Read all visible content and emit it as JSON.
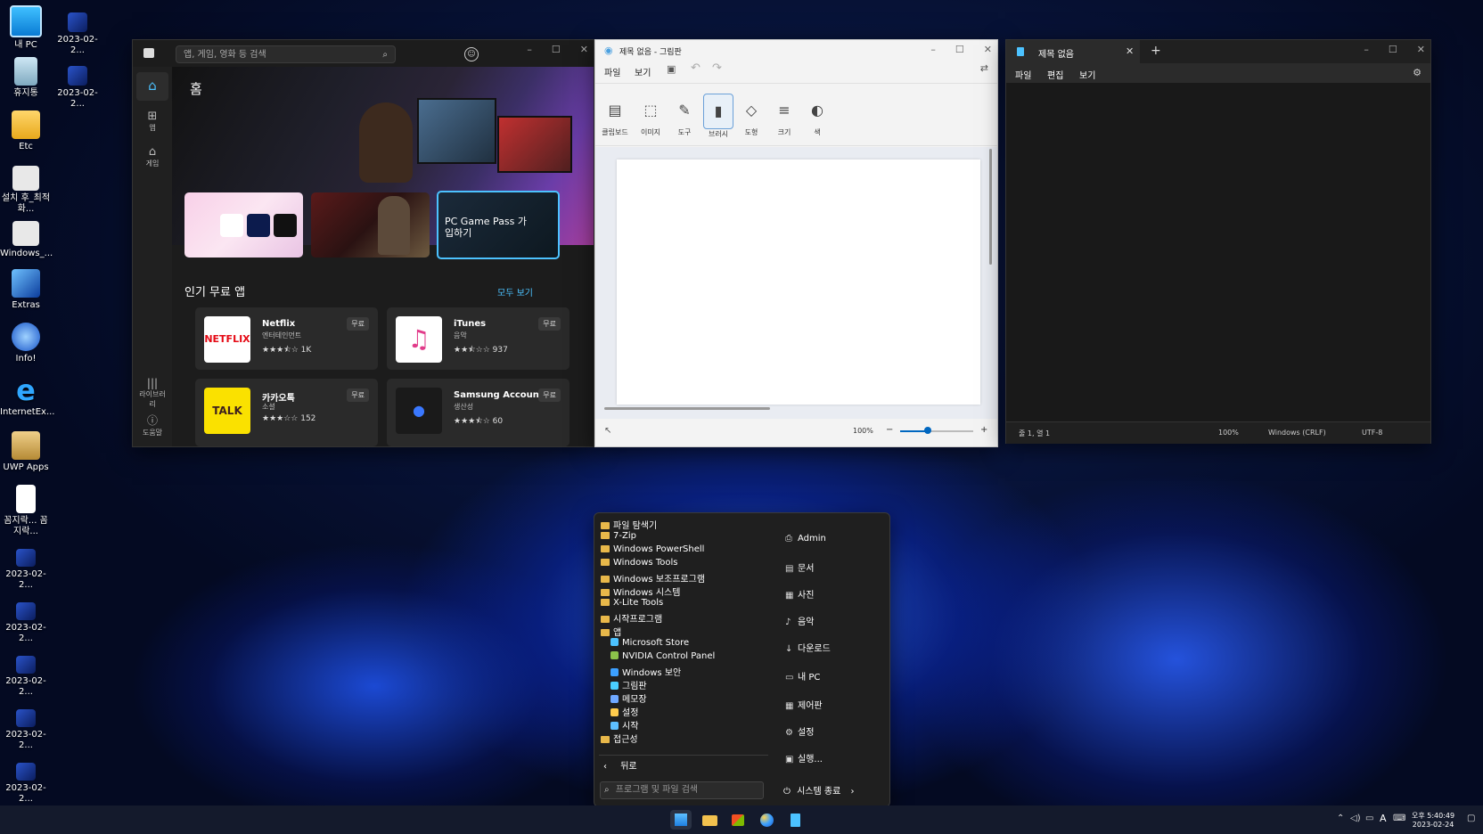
{
  "desktop": {
    "icons": [
      {
        "label": "내 PC"
      },
      {
        "label": "2023-02-2..."
      },
      {
        "label": "휴지통"
      },
      {
        "label": "2023-02-2..."
      },
      {
        "label": "Etc"
      },
      {
        "label": "설치 후_최적화..."
      },
      {
        "label": "Windows_..."
      },
      {
        "label": "Extras"
      },
      {
        "label": "Info!"
      },
      {
        "label": "InternetEx..."
      },
      {
        "label": "UWP Apps"
      },
      {
        "label": "꼼지락... 꼼지락..."
      },
      {
        "label": "2023-02-2..."
      },
      {
        "label": "2023-02-2..."
      },
      {
        "label": "2023-02-2..."
      },
      {
        "label": "2023-02-2..."
      },
      {
        "label": "2023-02-2..."
      }
    ]
  },
  "store": {
    "search_placeholder": "앱, 게임, 영화 등 검색",
    "rail": {
      "home": "",
      "apps": "앱",
      "games": "게임",
      "library": "라이브러리",
      "help": "도움말"
    },
    "home_title": "홈",
    "promo_gamepass": "PC Game Pass 가입하기",
    "section_title": "인기 무료 앱",
    "see_all": "모두 보기",
    "apps": [
      {
        "name": "Netflix",
        "category": "엔터테인먼트",
        "stars": "★★★⯪☆",
        "count": "1K",
        "price": "무료"
      },
      {
        "name": "iTunes",
        "category": "음악",
        "stars": "★★⯪☆☆",
        "count": "937",
        "price": "무료"
      },
      {
        "name": "카카오톡",
        "category": "소셜",
        "stars": "★★★☆☆",
        "count": "152",
        "price": "무료"
      },
      {
        "name": "Samsung Account",
        "category": "생산성",
        "stars": "★★★⯪☆",
        "count": "60",
        "price": "무료"
      }
    ]
  },
  "paint": {
    "title": "제목 없음 - 그림판",
    "menu": {
      "file": "파일",
      "view": "보기"
    },
    "tools": [
      "클립보드",
      "이미지",
      "도구",
      "브러시",
      "도형",
      "크기",
      "색"
    ],
    "zoom": "100%"
  },
  "notepad": {
    "tab_title": "제목 없음",
    "menu": {
      "file": "파일",
      "edit": "편집",
      "view": "보기"
    },
    "status": {
      "position": "줄 1, 열 1",
      "zoom": "100%",
      "eol": "Windows (CRLF)",
      "encoding": "UTF-8"
    }
  },
  "startmenu": {
    "left": [
      {
        "label": "파일 탐색기",
        "kind": "folder"
      },
      {
        "label": "7-Zip",
        "kind": "folder"
      },
      {
        "label": "Windows PowerShell",
        "kind": "folder"
      },
      {
        "label": "Windows Tools",
        "kind": "folder"
      },
      {
        "label": "Windows 보조프로그램",
        "kind": "folder"
      },
      {
        "label": "Windows 시스템",
        "kind": "folder"
      },
      {
        "label": "X-Lite Tools",
        "kind": "folder"
      },
      {
        "label": "시작프로그램",
        "kind": "folder"
      },
      {
        "label": "앱",
        "kind": "folder"
      },
      {
        "label": "Microsoft Store",
        "kind": "app"
      },
      {
        "label": "NVIDIA Control Panel",
        "kind": "app"
      },
      {
        "label": "Windows 보안",
        "kind": "app"
      },
      {
        "label": "그림판",
        "kind": "app"
      },
      {
        "label": "메모장",
        "kind": "app"
      },
      {
        "label": "설정",
        "kind": "app"
      },
      {
        "label": "시작",
        "kind": "app"
      },
      {
        "label": "접근성",
        "kind": "folder"
      }
    ],
    "back": "뒤로",
    "search_placeholder": "프로그램 및 파일 검색",
    "right": [
      {
        "label": "Admin"
      },
      {
        "label": "문서"
      },
      {
        "label": "사진"
      },
      {
        "label": "음악"
      },
      {
        "label": "다운로드"
      },
      {
        "label": "내 PC"
      },
      {
        "label": "제어판"
      },
      {
        "label": "설정"
      },
      {
        "label": "실행..."
      }
    ],
    "shutdown": "시스템 종료"
  },
  "taskbar": {
    "time": "오후 5:40:49",
    "date": "2023-02-24",
    "ime": "A"
  }
}
